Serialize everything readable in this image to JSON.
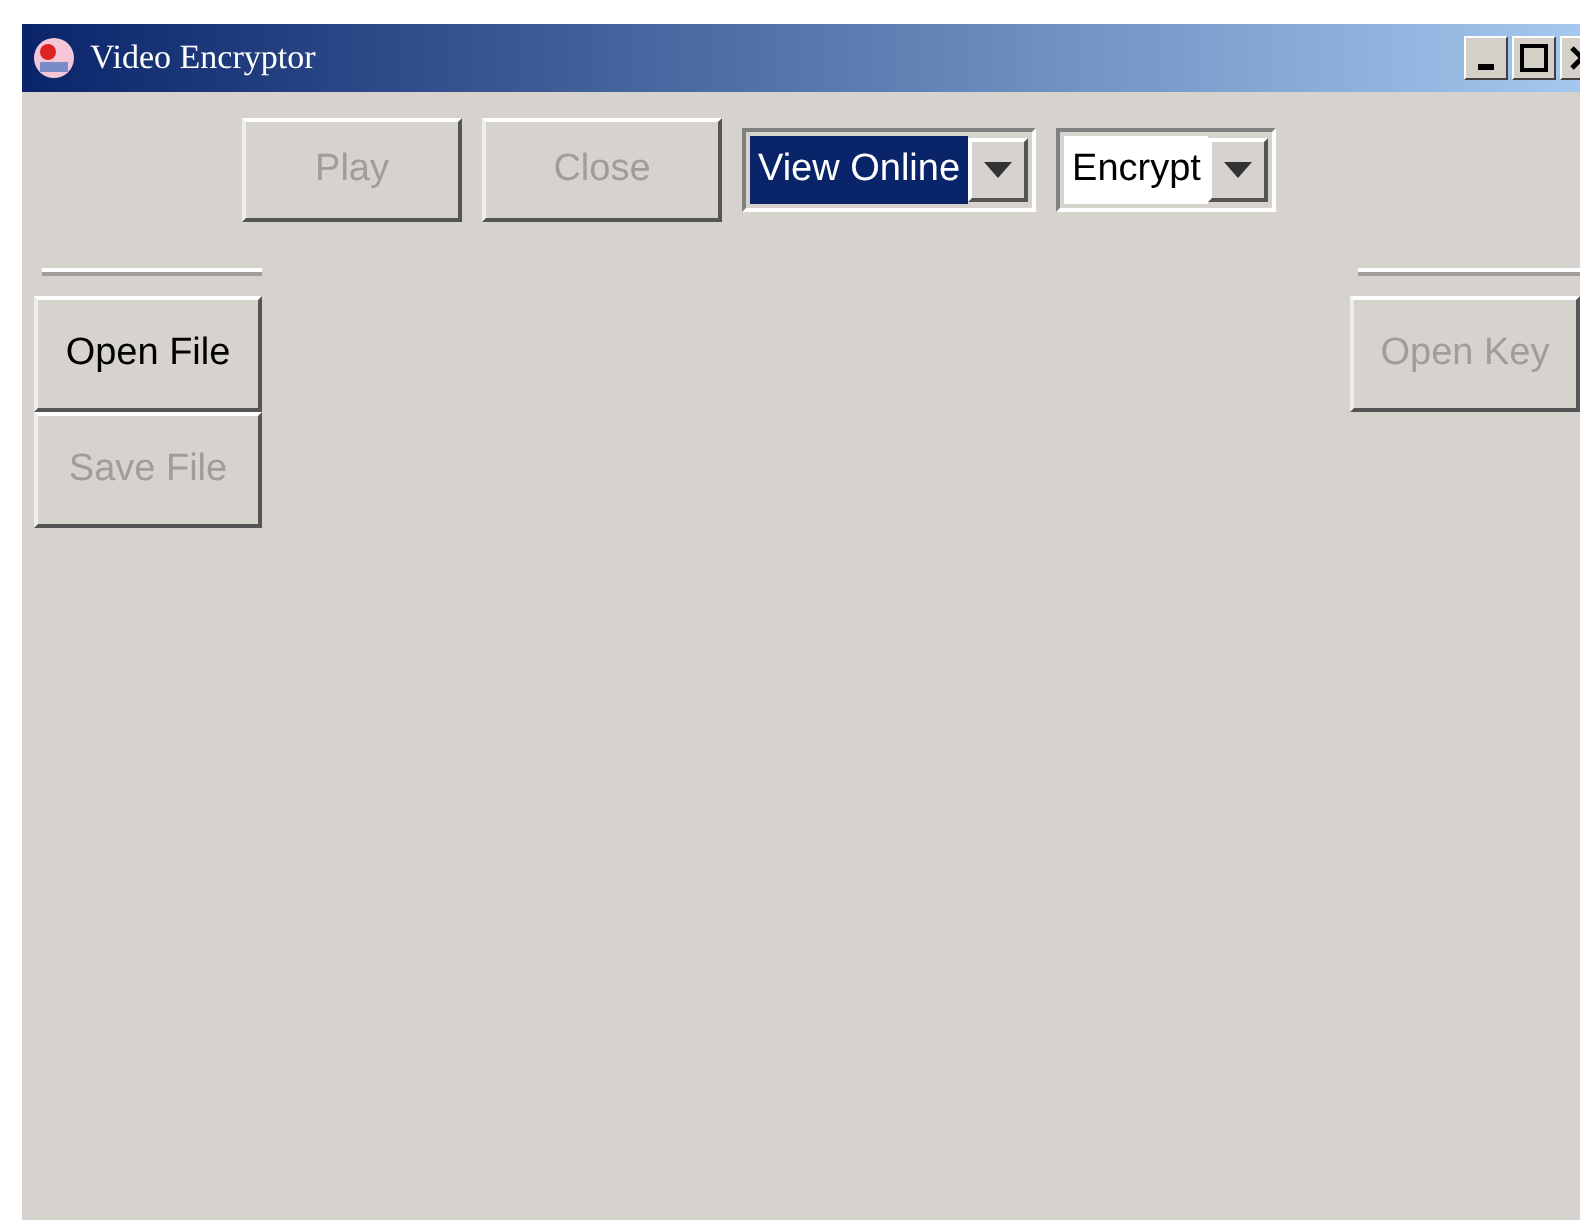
{
  "window": {
    "title": "Video Encryptor"
  },
  "toolbar": {
    "buttons": [
      {
        "label": "Play",
        "disabled": true
      },
      {
        "label": "Close",
        "disabled": true
      }
    ],
    "dropdowns": [
      {
        "value": "View Online",
        "focused": true
      },
      {
        "value": "Encrypt",
        "focused": false
      }
    ]
  },
  "left_toolbar": {
    "buttons": [
      {
        "label": "Open File",
        "disabled": false
      },
      {
        "label": "Save File",
        "disabled": true
      }
    ]
  },
  "right_toolbar": {
    "buttons": [
      {
        "label": "Open Key",
        "disabled": true
      }
    ]
  }
}
